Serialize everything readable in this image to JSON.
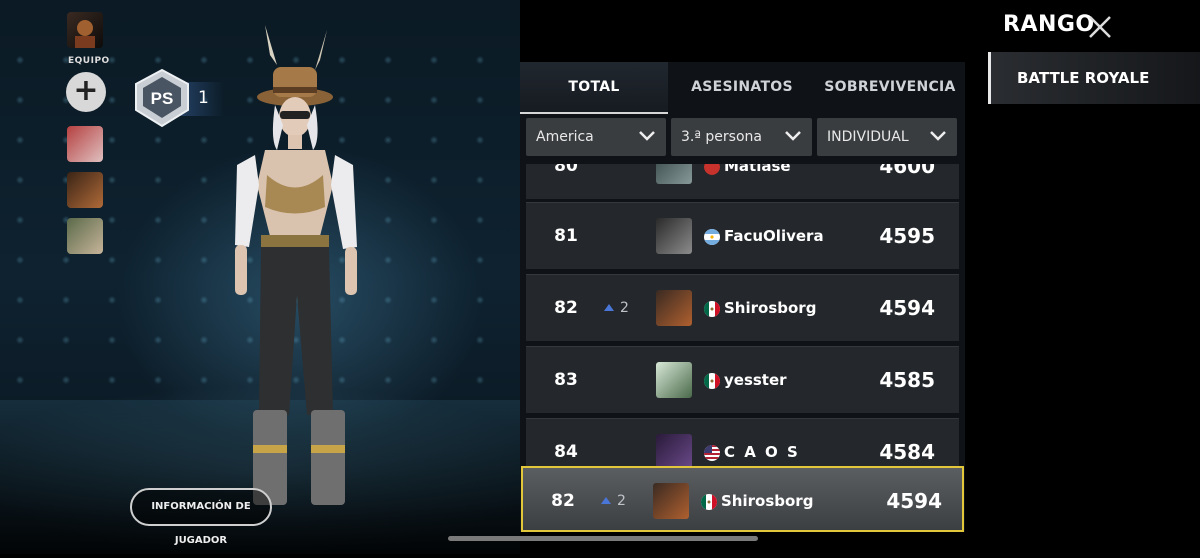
{
  "team": {
    "label": "EQUIPO",
    "add_symbol": "+"
  },
  "player": {
    "rank_badge_text": "PS",
    "rank_value": "1",
    "info_button": "INFORMACIÓN DE JUGADOR"
  },
  "header": {
    "title": "RANGO",
    "close_icon": "close-icon"
  },
  "modes": {
    "active": "BATTLE ROYALE"
  },
  "tabs": [
    {
      "label": "TOTAL",
      "active": true
    },
    {
      "label": "ASESINATOS",
      "active": false
    },
    {
      "label": "SOBREVIVENCIA",
      "active": false
    }
  ],
  "filters": {
    "region": "America",
    "perspective": "3.ª persona",
    "mode": "INDIVIDUAL"
  },
  "leaderboard": {
    "rows": [
      {
        "pos": "80",
        "change": "",
        "name": "Matiase",
        "score": "4600",
        "flag": "red-circle"
      },
      {
        "pos": "81",
        "change": "",
        "name": "FacuOlivera",
        "score": "4595",
        "flag": "argentina"
      },
      {
        "pos": "82",
        "change": "2",
        "name": "Shirosborg",
        "score": "4594",
        "flag": "mexico"
      },
      {
        "pos": "83",
        "change": "",
        "name": "yesster",
        "score": "4585",
        "flag": "mexico"
      },
      {
        "pos": "84",
        "change": "",
        "name": "C A O S",
        "score": "4584",
        "flag": "usa"
      }
    ],
    "self": {
      "pos": "82",
      "change": "2",
      "name": "Shirosborg",
      "score": "4594",
      "flag": "mexico"
    }
  },
  "colors": {
    "highlight_border": "#e3c73b",
    "rank_up_arrow": "#4a76d8"
  }
}
